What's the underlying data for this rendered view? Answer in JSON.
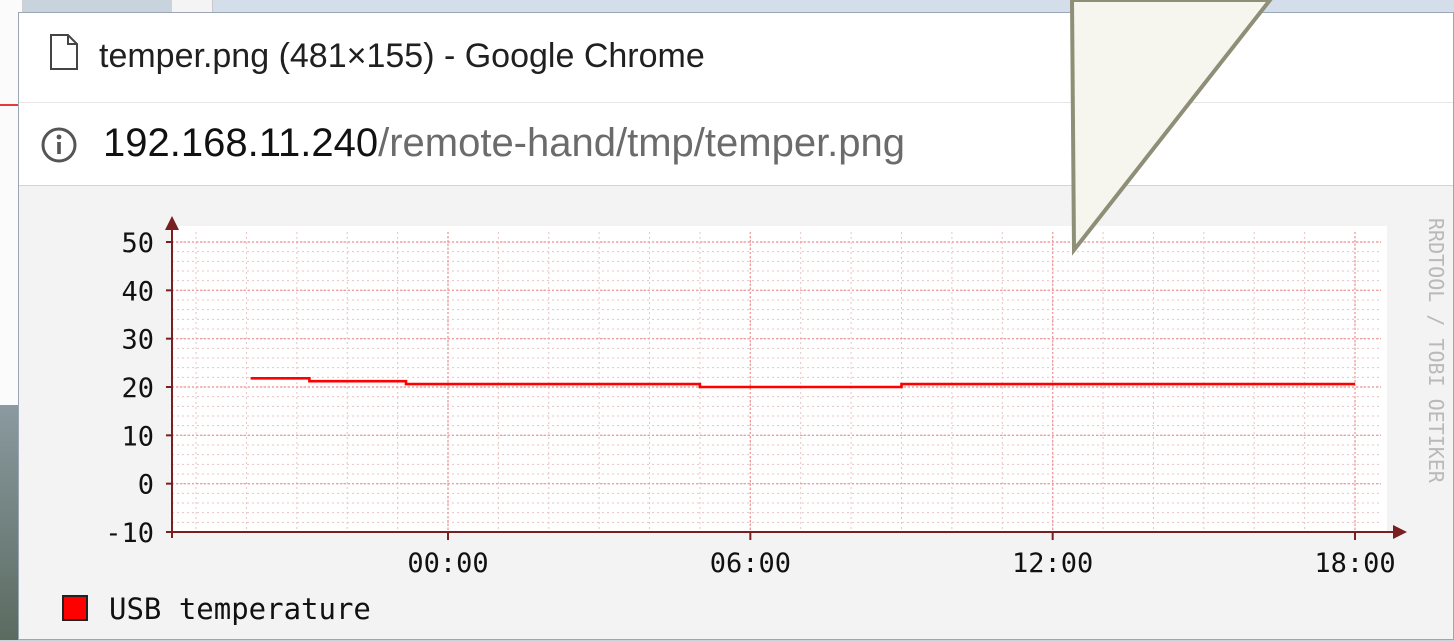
{
  "window": {
    "title": "temper.png (481×155) - Google Chrome"
  },
  "address": {
    "host": "192.168.11.240",
    "path": "/remote-hand/tmp/temper.png"
  },
  "icons": {
    "page": "document-icon",
    "info": "info-icon"
  },
  "colors": {
    "series": "#ff0000",
    "grid": "#f0a0a0",
    "axis": "#7a1f1f",
    "canvas": "#f3f3f3"
  },
  "chart_data": {
    "type": "line",
    "watermark": "RRDTOOL / TOBI OETIKER",
    "y_ticks": [
      "50",
      "40",
      "30",
      "20",
      "10",
      "0",
      "-10"
    ],
    "x_ticks": [
      "00:00",
      "06:00",
      "12:00",
      "18:00"
    ],
    "ylim": [
      -10,
      50
    ],
    "grid": true,
    "legend": {
      "placement": "bottom-left",
      "label": "USB temperature"
    },
    "series": [
      {
        "name": "USB temperature",
        "color": "#ff0000",
        "points": [
          [
            "-03:55",
            21.8
          ],
          [
            "-02:45",
            21.8
          ],
          [
            "-02:45",
            21.2
          ],
          [
            "-00:50",
            21.2
          ],
          [
            "-00:50",
            20.6
          ],
          [
            "05:00",
            20.6
          ],
          [
            "05:00",
            20.0
          ],
          [
            "09:00",
            20.0
          ],
          [
            "09:00",
            20.6
          ],
          [
            "18:00",
            20.6
          ]
        ]
      }
    ]
  }
}
